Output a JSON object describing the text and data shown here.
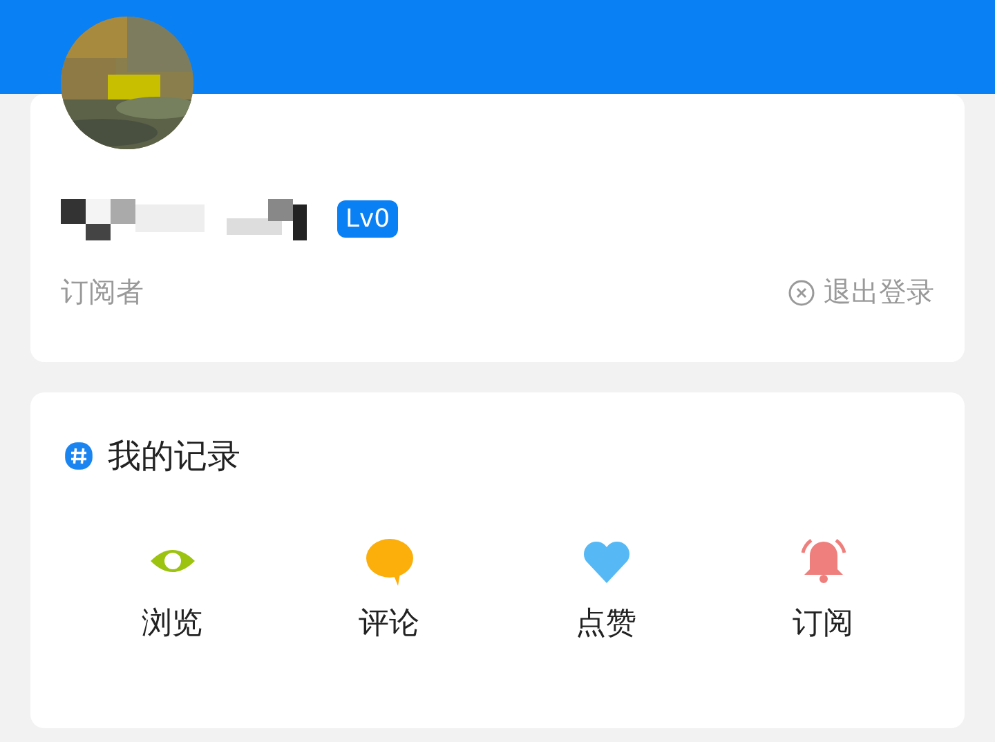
{
  "profile": {
    "level_badge": "Lv0",
    "role": "订阅者",
    "logout_button": "退出登录"
  },
  "records": {
    "title": "我的记录",
    "items": [
      {
        "kind": "eye",
        "label": "浏览",
        "color": "#9cc30f"
      },
      {
        "kind": "comment",
        "label": "评论",
        "color": "#fcae0a"
      },
      {
        "kind": "heart",
        "label": "点赞",
        "color": "#56b9f5"
      },
      {
        "kind": "bell",
        "label": "订阅",
        "color": "#ef7f7c"
      }
    ]
  }
}
